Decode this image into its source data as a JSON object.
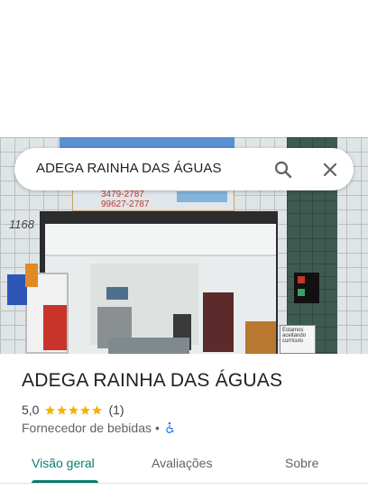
{
  "search": {
    "query": "ADEGA RAINHA DAS ÁGUAS"
  },
  "photo": {
    "address_number": "1168",
    "sign_phones": [
      "3479-2787",
      "99627-2787"
    ],
    "note_text": "Estamos aceitando currículo"
  },
  "place": {
    "name": "ADEGA RAINHA DAS ÁGUAS",
    "rating": "5,0",
    "stars": 5,
    "review_count": "(1)",
    "category": "Fornecedor de bebidas",
    "separator": "•"
  },
  "tabs": [
    {
      "label": "Visão geral",
      "active": true
    },
    {
      "label": "Avaliações",
      "active": false
    },
    {
      "label": "Sobre",
      "active": false
    }
  ],
  "colors": {
    "accent": "#0b7d6f",
    "star": "#f4b400",
    "wheelchair": "#1a73e8"
  },
  "icons": {
    "search": "search-icon",
    "close": "close-icon",
    "star": "star-icon",
    "accessibility": "wheelchair-icon"
  }
}
